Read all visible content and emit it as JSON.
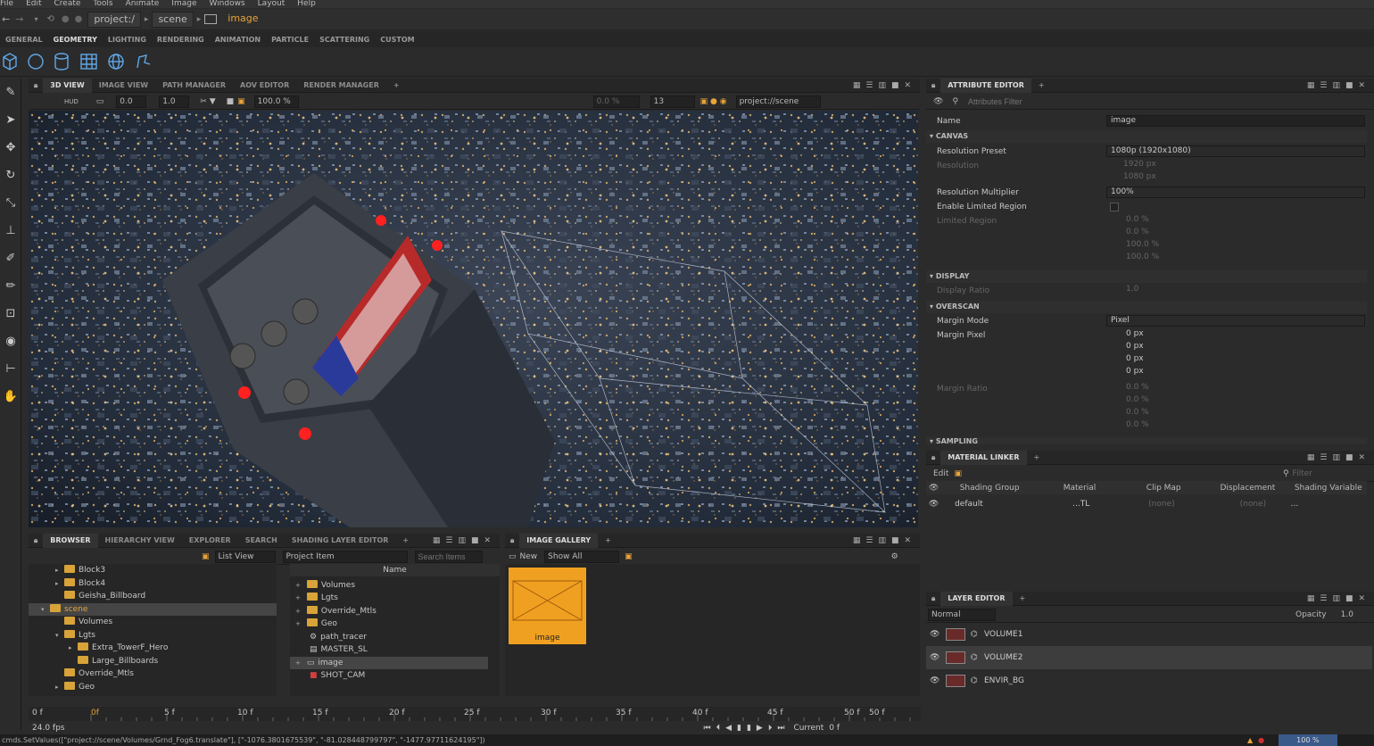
{
  "menu": [
    "File",
    "Edit",
    "Create",
    "Tools",
    "Animate",
    "Image",
    "Windows",
    "Layout",
    "Help"
  ],
  "address": {
    "crumbs": [
      "project:/",
      "scene"
    ],
    "current": "image"
  },
  "shelf_tabs": [
    "GENERAL",
    "GEOMETRY",
    "LIGHTING",
    "RENDERING",
    "ANIMATION",
    "PARTICLE",
    "SCATTERING",
    "CUSTOM"
  ],
  "shelf_icons": [
    "box-icon",
    "circle-icon",
    "cylinder-icon",
    "grid-icon",
    "sphere-icon",
    "bolt-icon"
  ],
  "viewport": {
    "tabs": [
      "3D VIEW",
      "IMAGE VIEW",
      "PATH MANAGER",
      "AOV EDITOR",
      "RENDER MANAGER"
    ],
    "toolbar": {
      "hud": "HUD",
      "v1": "0.0",
      "v2": "1.0",
      "zoom": "100.0 %",
      "rv1": "0.0 %",
      "rv2": "13",
      "path": "project://scene"
    }
  },
  "attribute_editor": {
    "title": "ATTRIBUTE EDITOR",
    "filter_placeholder": "Attributes Filter",
    "name_label": "Name",
    "name_value": "image",
    "sections": {
      "canvas": "CANVAS",
      "display": "DISPLAY",
      "overscan": "OVERSCAN",
      "sampling": "SAMPLING"
    },
    "resolution_preset_label": "Resolution Preset",
    "resolution_preset": "1080p (1920x1080)",
    "resolution_label": "Resolution",
    "res_w": "1920 px",
    "res_h": "1080 px",
    "res_mult_label": "Resolution Multiplier",
    "res_mult": "100%",
    "limited_label": "Enable Limited Region",
    "limited_region_label": "Limited Region",
    "limited_vals": [
      "0.0 %",
      "0.0 %",
      "100.0 %",
      "100.0 %"
    ],
    "display_ratio_label": "Display Ratio",
    "display_ratio": "1.0",
    "margin_mode_label": "Margin Mode",
    "margin_mode": "Pixel",
    "margin_pixel_label": "Margin Pixel",
    "margin_px": [
      "0 px",
      "0 px",
      "0 px",
      "0 px"
    ],
    "margin_ratio_label": "Margin Ratio",
    "margin_ratio": [
      "0.0 %",
      "0.0 %",
      "0.0 %",
      "0.0 %"
    ]
  },
  "material_linker": {
    "title": "MATERIAL LINKER",
    "edit": "Edit",
    "filter_placeholder": "Filter",
    "columns": [
      "Shading Group",
      "Material",
      "Clip Map",
      "Displacement",
      "Shading Variable"
    ],
    "row": {
      "group": "default",
      "material": "...TL",
      "clip": "(none)",
      "disp": "(none)",
      "var": "..."
    }
  },
  "layer_editor": {
    "title": "LAYER EDITOR",
    "blend": "Normal",
    "opacity_label": "Opacity",
    "opacity": "1.0",
    "layers": [
      "VOLUME1",
      "VOLUME2",
      "ENVIR_BG"
    ]
  },
  "browser": {
    "tabs": [
      "BROWSER",
      "HIERARCHY VIEW",
      "EXPLORER",
      "SEARCH",
      "SHADING LAYER EDITOR"
    ],
    "list_view": "List View",
    "project_item": "Project Item",
    "search_placeholder": "Search Items",
    "name_col": "Name",
    "tree": [
      "Block3",
      "Block4",
      "Geisha_Billboard",
      "scene",
      "Volumes",
      "Lgts",
      "Extra_TowerF_Hero",
      "Large_Billboards",
      "Override_Mtls",
      "Geo"
    ],
    "items": [
      "Volumes",
      "Lgts",
      "Override_Mtls",
      "Geo",
      "path_tracer",
      "MASTER_SL",
      "image",
      "SHOT_CAM"
    ]
  },
  "gallery": {
    "title": "IMAGE GALLERY",
    "new": "New",
    "show": "Show All",
    "thumb_label": "image"
  },
  "timeline": {
    "ticks": [
      "0f",
      "5 f",
      "10 f",
      "15 f",
      "20 f",
      "25 f",
      "30 f",
      "35 f",
      "40 f",
      "45 f",
      "50 f"
    ],
    "start": "0 f",
    "end": "50 f",
    "fps": "24.0 fps",
    "current_label": "Current",
    "current": "0 f"
  },
  "status": {
    "cmd": "cmds.SetValues([\"project://scene/Volumes/Grnd_Fog6.translate\"], [\"-1076.3801675539\", \"-81.028448799797\", \"-1477.97711624195\"])",
    "zoom": "100 %"
  }
}
